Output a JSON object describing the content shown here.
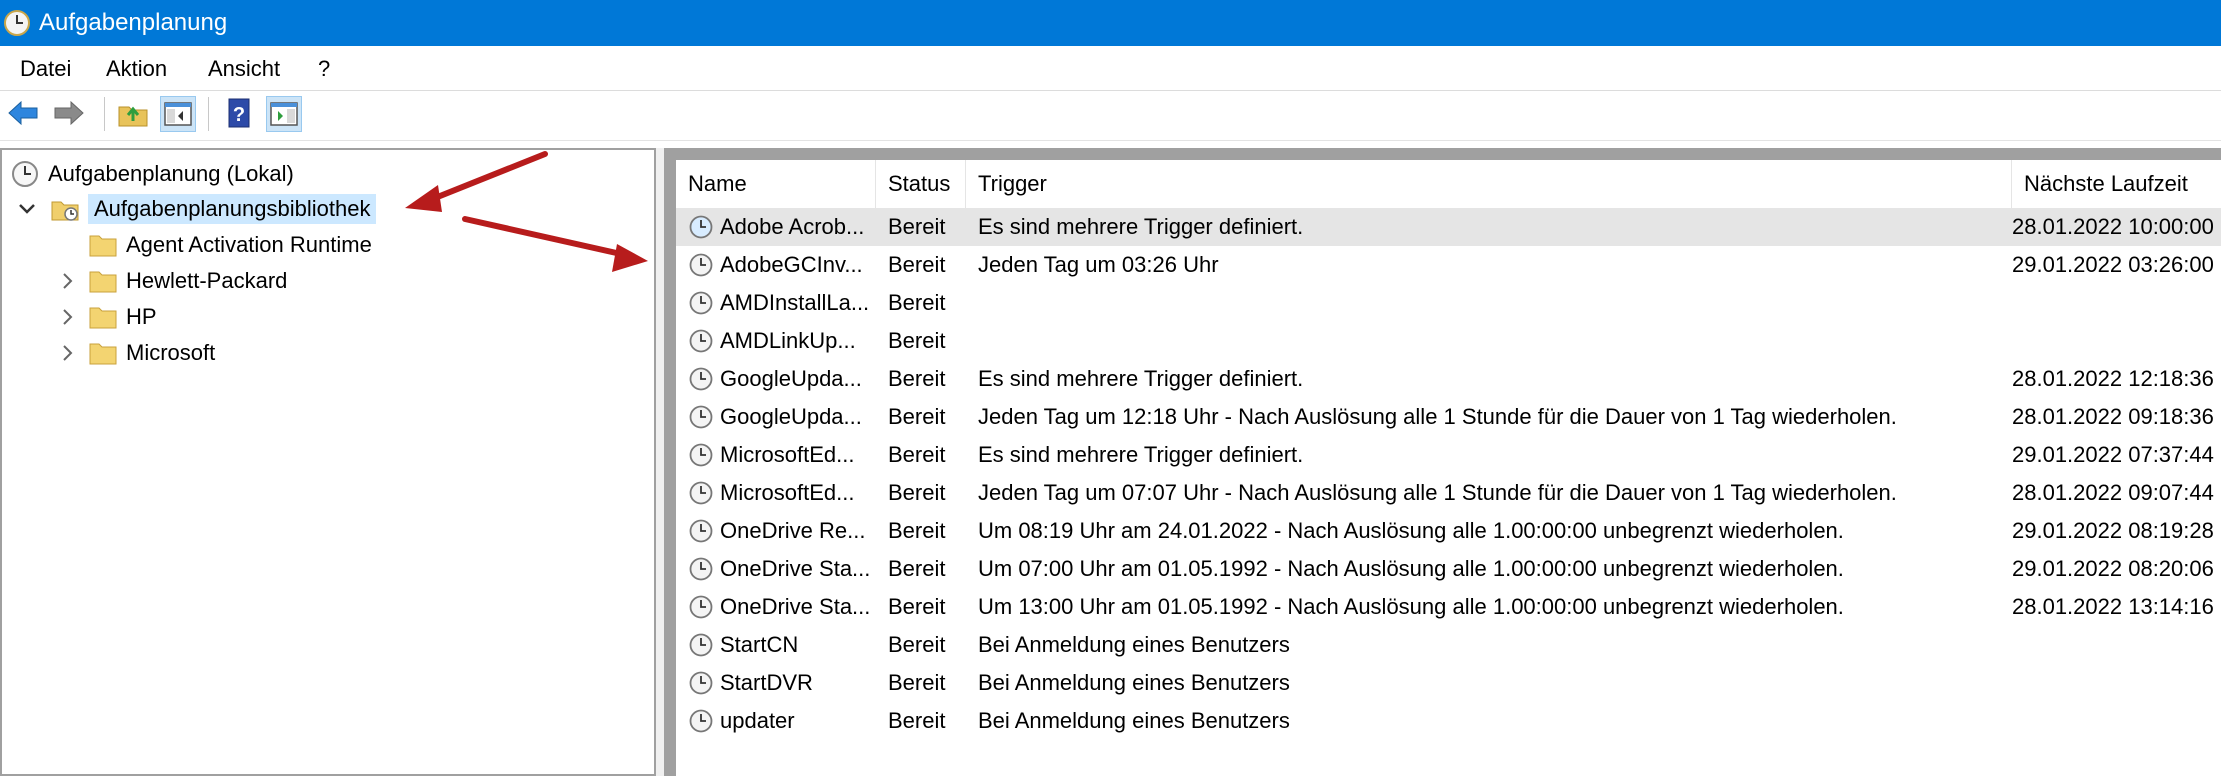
{
  "window": {
    "title": "Aufgabenplanung"
  },
  "menu": [
    "Datei",
    "Aktion",
    "Ansicht",
    "?"
  ],
  "toolbar": {
    "icons": [
      "back-arrow-icon",
      "forward-arrow-icon",
      "folder-up-icon",
      "show-console-tree-icon",
      "help-icon",
      "show-action-pane-icon"
    ]
  },
  "tree": {
    "root": "Aufgabenplanung (Lokal)",
    "library": "Aufgabenplanungsbibliothek",
    "folders": [
      "Agent Activation Runtime",
      "Hewlett-Packard",
      "HP",
      "Microsoft"
    ]
  },
  "list": {
    "columns": [
      "Name",
      "Status",
      "Trigger",
      "Nächste Laufzeit"
    ],
    "rows": [
      {
        "name": "Adobe Acrob...",
        "status": "Bereit",
        "trigger": "Es sind mehrere Trigger definiert.",
        "next": "28.01.2022 10:00:00"
      },
      {
        "name": "AdobeGCInv...",
        "status": "Bereit",
        "trigger": "Jeden Tag um 03:26 Uhr",
        "next": "29.01.2022 03:26:00"
      },
      {
        "name": "AMDInstallLa...",
        "status": "Bereit",
        "trigger": "",
        "next": ""
      },
      {
        "name": "AMDLinkUp...",
        "status": "Bereit",
        "trigger": "",
        "next": ""
      },
      {
        "name": "GoogleUpda...",
        "status": "Bereit",
        "trigger": "Es sind mehrere Trigger definiert.",
        "next": "28.01.2022 12:18:36"
      },
      {
        "name": "GoogleUpda...",
        "status": "Bereit",
        "trigger": "Jeden Tag um 12:18 Uhr - Nach Auslösung alle 1 Stunde für die Dauer von 1 Tag wiederholen.",
        "next": "28.01.2022 09:18:36"
      },
      {
        "name": "MicrosoftEd...",
        "status": "Bereit",
        "trigger": "Es sind mehrere Trigger definiert.",
        "next": "29.01.2022 07:37:44"
      },
      {
        "name": "MicrosoftEd...",
        "status": "Bereit",
        "trigger": "Jeden Tag um 07:07 Uhr - Nach Auslösung alle 1 Stunde für die Dauer von 1 Tag wiederholen.",
        "next": "28.01.2022 09:07:44"
      },
      {
        "name": "OneDrive Re...",
        "status": "Bereit",
        "trigger": "Um 08:19 Uhr am 24.01.2022 - Nach Auslösung alle 1.00:00:00 unbegrenzt wiederholen.",
        "next": "29.01.2022 08:19:28"
      },
      {
        "name": "OneDrive Sta...",
        "status": "Bereit",
        "trigger": "Um 07:00 Uhr am 01.05.1992 - Nach Auslösung alle 1.00:00:00 unbegrenzt wiederholen.",
        "next": "29.01.2022 08:20:06"
      },
      {
        "name": "OneDrive Sta...",
        "status": "Bereit",
        "trigger": "Um 13:00 Uhr am 01.05.1992 - Nach Auslösung alle 1.00:00:00 unbegrenzt wiederholen.",
        "next": "28.01.2022 13:14:16"
      },
      {
        "name": "StartCN",
        "status": "Bereit",
        "trigger": "Bei Anmeldung eines Benutzers",
        "next": ""
      },
      {
        "name": "StartDVR",
        "status": "Bereit",
        "trigger": "Bei Anmeldung eines Benutzers",
        "next": ""
      },
      {
        "name": "updater",
        "status": "Bereit",
        "trigger": "Bei Anmeldung eines Benutzers",
        "next": ""
      }
    ]
  },
  "colors": {
    "titlebar": "#0078d7",
    "selection": "#cce8ff",
    "annotation_arrow": "#b71c1c"
  }
}
